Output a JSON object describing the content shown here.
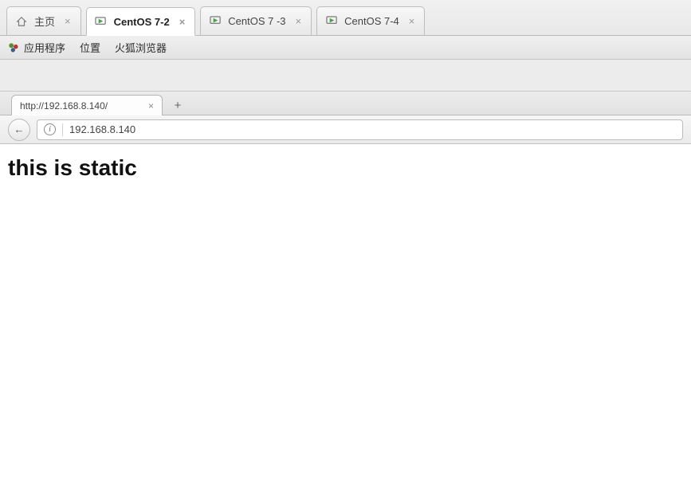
{
  "vm_tabs": [
    {
      "label": "主页",
      "kind": "home",
      "close": "×"
    },
    {
      "label": "CentOS 7-2",
      "kind": "vm",
      "active": true,
      "close": "×"
    },
    {
      "label": "CentOS 7 -3",
      "kind": "vm",
      "close": "×"
    },
    {
      "label": "CentOS 7-4",
      "kind": "vm",
      "close": "×"
    }
  ],
  "gnome_menu": {
    "apps": "应用程序",
    "places": "位置",
    "firefox": "火狐浏览器"
  },
  "firefox": {
    "tab_title": "http://192.168.8.140/",
    "tab_close": "×",
    "new_tab": "+",
    "back_arrow": "←",
    "url_info": "i",
    "address": "192.168.8.140"
  },
  "page": {
    "heading": "this is static"
  }
}
